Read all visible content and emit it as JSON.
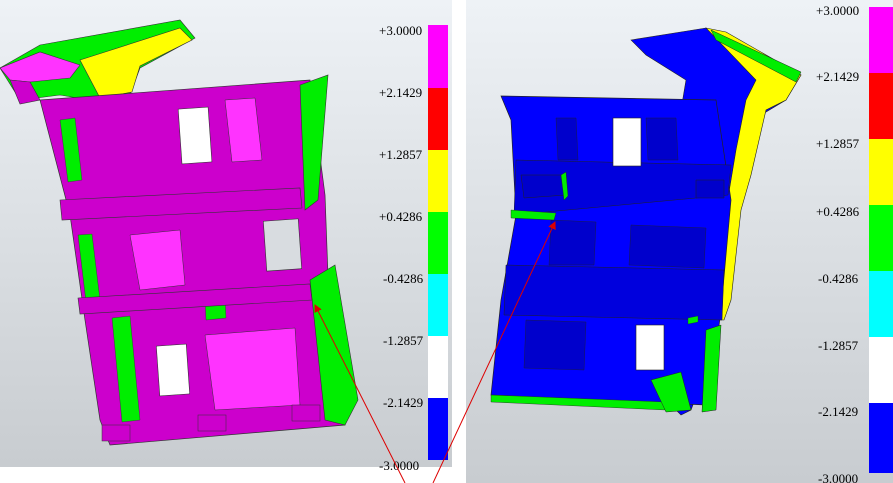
{
  "figure": {
    "left_panel": {
      "scale_labels": [
        "+3.0000",
        "+2.1429",
        "+1.2857",
        "+0.4286",
        "-0.4286",
        "-1.2857",
        "-2.1429",
        "-3.0000"
      ],
      "scale_colors": [
        "#ff00ff",
        "#ff0000",
        "#ffff00",
        "#00ff00",
        "#00ffff",
        "#ffffff",
        "#0000ff"
      ]
    },
    "right_panel": {
      "scale_labels": [
        "+3.0000",
        "+2.1429",
        "+1.2857",
        "+0.4286",
        "-0.4286",
        "-1.2857",
        "-2.1429",
        "-3.0000"
      ],
      "scale_colors": [
        "#ff00ff",
        "#ff0000",
        "#ffff00",
        "#00ff00",
        "#00ffff",
        "#ffffff",
        "#0000ff"
      ]
    },
    "colors": {
      "magenta": "#cc00cc",
      "magenta_light": "#ff33ff",
      "green": "#00ee00",
      "yellow": "#ffff00",
      "blue": "#0000ff",
      "blue_dark": "#0000aa",
      "arrow": "#dd0000"
    }
  }
}
